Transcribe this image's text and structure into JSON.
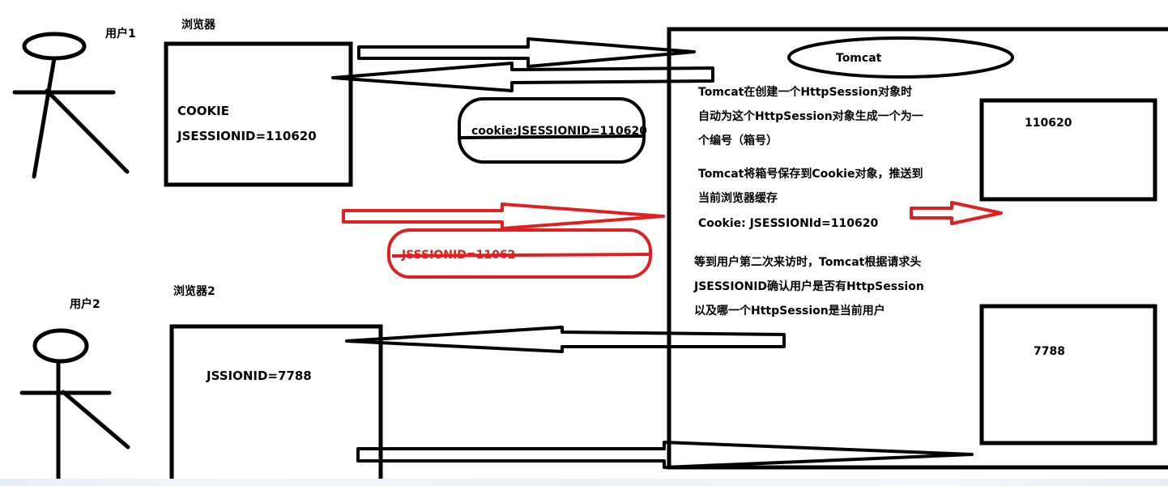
{
  "diagram": {
    "user1": {
      "label": "用户1"
    },
    "user2": {
      "label": "用户2"
    },
    "browser1": {
      "title": "浏览器",
      "cookie_title": "COOKIE",
      "cookie_value": "JSESSIONID=110620"
    },
    "browser2": {
      "title": "浏览器2",
      "cookie_value": "JSSIONID=7788"
    },
    "cookie_transfer": {
      "text": "cookie:JSESSIONID=110620"
    },
    "red_request": {
      "text": "JSSSIONID=11062"
    },
    "tomcat": {
      "title": "Tomcat",
      "note1_line1": "Tomcat在创建一个HttpSession对象时",
      "note1_line2": "自动为这个HttpSession对象生成一个为一",
      "note1_line3": "个编号（箱号）",
      "note2_line1": "Tomcat将箱号保存到Cookie对象，推送到",
      "note2_line2": "当前浏览器缓存",
      "note2_line3": "Cookie: JSESSIONId=110620",
      "note3_line1": "等到用户第二次来访时，Tomcat根据请求头",
      "note3_line2": "JSESSIONID确认用户是否有HttpSession",
      "note3_line3": "以及哪一个HttpSession是当前用户"
    },
    "session_box_1": {
      "value": "110620"
    },
    "session_box_2": {
      "value": "7788"
    },
    "colors": {
      "ink": "#000000",
      "highlight": "#e02020"
    }
  }
}
